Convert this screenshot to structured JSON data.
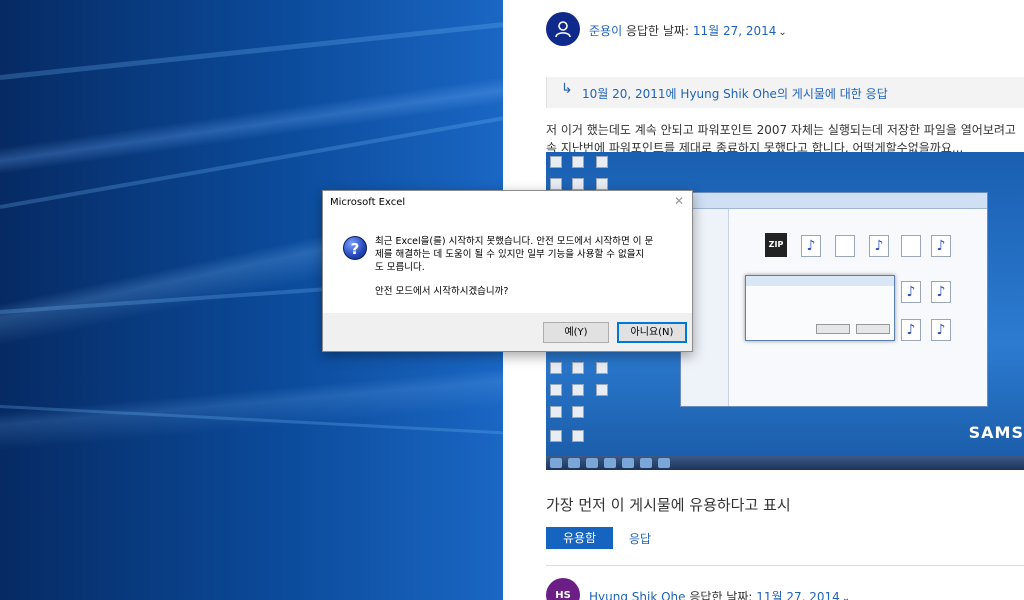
{
  "reply1": {
    "user": "준용이",
    "action": "응답한 날짜:",
    "date": "11월 27, 2014"
  },
  "quote": {
    "text": "10월 20, 2011에 Hyung Shik Ohe의 게시물에 대한 응답"
  },
  "post": {
    "body": "저 이거 했는데도 계속 안되고 파워포인트 2007 자체는 실행되는데 저장한 파일을 열어보려고\n속 지난번에 파워포인트를 제대로 종료하지 못했다고 합니다. 어떡게할수없을까요..."
  },
  "screenshot": {
    "brand": "SAMS",
    "zip_label": "ZIP"
  },
  "helpful": {
    "prompt": "가장 먼저 이 게시물에 유용하다고 표시",
    "helpful_label": "유용함",
    "reply_label": "응답"
  },
  "reply2": {
    "avatar_initials": "HS",
    "user": "Hyung Shik Ohe",
    "action": "응답한 날짜:",
    "date": "11월 27, 2014"
  },
  "dialog": {
    "title": "Microsoft Excel",
    "message": "최근 Excel을(를) 시작하지 못했습니다. 안전 모드에서 시작하면 이 문\n제를 해결하는 데 도움이 될 수 있지만 일부 기능을 사용할 수 없을지\n도 모릅니다.",
    "question": "안전 모드에서 시작하시겠습니까?",
    "yes_label": "예(Y)",
    "no_label": "아니요(N)",
    "close_glyph": "✕",
    "icon_glyph": "?"
  },
  "colors": {
    "accent": "#1565c0",
    "link": "#1f63b8",
    "desktop": "#0b4a9a"
  }
}
